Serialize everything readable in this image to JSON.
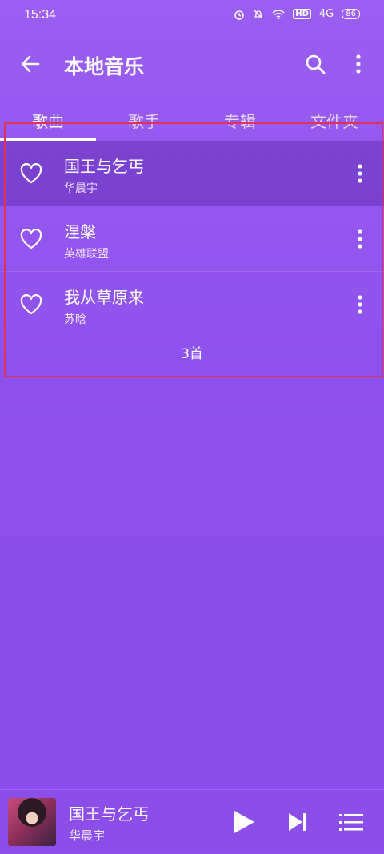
{
  "status": {
    "time": "15:34",
    "hd": "HD",
    "network": "4G",
    "battery": "86"
  },
  "appbar": {
    "title": "本地音乐"
  },
  "tabs": [
    {
      "label": "歌曲"
    },
    {
      "label": "歌手"
    },
    {
      "label": "专辑"
    },
    {
      "label": "文件夹"
    }
  ],
  "songs": [
    {
      "title": "国王与乞丐",
      "artist": "华晨宇"
    },
    {
      "title": "涅槃",
      "artist": "英雄联盟"
    },
    {
      "title": "我从草原来",
      "artist": "苏晗"
    }
  ],
  "count_label": "3首",
  "now_playing": {
    "title": "国王与乞丐",
    "artist": "华晨宇"
  },
  "colors": {
    "background": "#8c4fee",
    "highlight_row": "#7440c8",
    "selection_border": "#e0315a"
  }
}
